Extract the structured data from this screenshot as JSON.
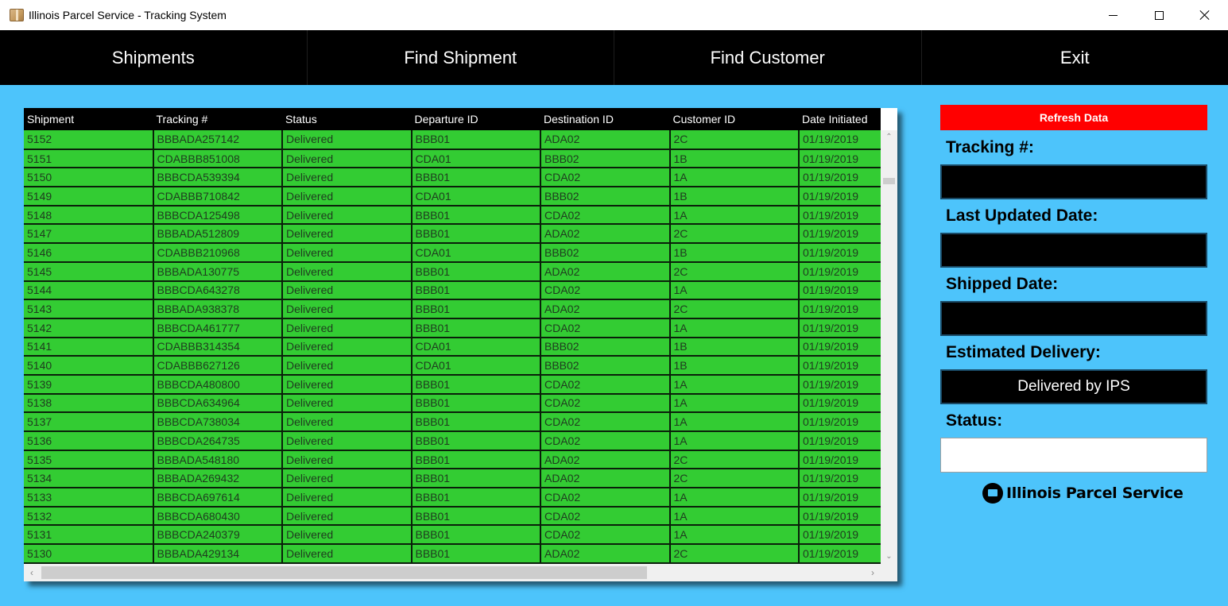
{
  "window": {
    "title": "Illinois Parcel Service - Tracking System",
    "icon": "package-box-icon"
  },
  "nav": {
    "items": [
      "Shipments",
      "Find Shipment",
      "Find Customer",
      "Exit"
    ]
  },
  "grid": {
    "columns": [
      "Shipment",
      "Tracking #",
      "Status",
      "Departure ID",
      "Destination ID",
      "Customer ID",
      "Date Initiated"
    ],
    "rows": [
      [
        "5152",
        "BBBADA257142",
        "Delivered",
        "BBB01",
        "ADA02",
        "2C",
        "01/19/2019"
      ],
      [
        "5151",
        "CDABBB851008",
        "Delivered",
        "CDA01",
        "BBB02",
        "1B",
        "01/19/2019"
      ],
      [
        "5150",
        "BBBCDA539394",
        "Delivered",
        "BBB01",
        "CDA02",
        "1A",
        "01/19/2019"
      ],
      [
        "5149",
        "CDABBB710842",
        "Delivered",
        "CDA01",
        "BBB02",
        "1B",
        "01/19/2019"
      ],
      [
        "5148",
        "BBBCDA125498",
        "Delivered",
        "BBB01",
        "CDA02",
        "1A",
        "01/19/2019"
      ],
      [
        "5147",
        "BBBADA512809",
        "Delivered",
        "BBB01",
        "ADA02",
        "2C",
        "01/19/2019"
      ],
      [
        "5146",
        "CDABBB210968",
        "Delivered",
        "CDA01",
        "BBB02",
        "1B",
        "01/19/2019"
      ],
      [
        "5145",
        "BBBADA130775",
        "Delivered",
        "BBB01",
        "ADA02",
        "2C",
        "01/19/2019"
      ],
      [
        "5144",
        "BBBCDA643278",
        "Delivered",
        "BBB01",
        "CDA02",
        "1A",
        "01/19/2019"
      ],
      [
        "5143",
        "BBBADA938378",
        "Delivered",
        "BBB01",
        "ADA02",
        "2C",
        "01/19/2019"
      ],
      [
        "5142",
        "BBBCDA461777",
        "Delivered",
        "BBB01",
        "CDA02",
        "1A",
        "01/19/2019"
      ],
      [
        "5141",
        "CDABBB314354",
        "Delivered",
        "CDA01",
        "BBB02",
        "1B",
        "01/19/2019"
      ],
      [
        "5140",
        "CDABBB627126",
        "Delivered",
        "CDA01",
        "BBB02",
        "1B",
        "01/19/2019"
      ],
      [
        "5139",
        "BBBCDA480800",
        "Delivered",
        "BBB01",
        "CDA02",
        "1A",
        "01/19/2019"
      ],
      [
        "5138",
        "BBBCDA634964",
        "Delivered",
        "BBB01",
        "CDA02",
        "1A",
        "01/19/2019"
      ],
      [
        "5137",
        "BBBCDA738034",
        "Delivered",
        "BBB01",
        "CDA02",
        "1A",
        "01/19/2019"
      ],
      [
        "5136",
        "BBBCDA264735",
        "Delivered",
        "BBB01",
        "CDA02",
        "1A",
        "01/19/2019"
      ],
      [
        "5135",
        "BBBADA548180",
        "Delivered",
        "BBB01",
        "ADA02",
        "2C",
        "01/19/2019"
      ],
      [
        "5134",
        "BBBADA269432",
        "Delivered",
        "BBB01",
        "ADA02",
        "2C",
        "01/19/2019"
      ],
      [
        "5133",
        "BBBCDA697614",
        "Delivered",
        "BBB01",
        "CDA02",
        "1A",
        "01/19/2019"
      ],
      [
        "5132",
        "BBBCDA680430",
        "Delivered",
        "BBB01",
        "CDA02",
        "1A",
        "01/19/2019"
      ],
      [
        "5131",
        "BBBCDA240379",
        "Delivered",
        "BBB01",
        "CDA02",
        "1A",
        "01/19/2019"
      ],
      [
        "5130",
        "BBBADA429134",
        "Delivered",
        "BBB01",
        "ADA02",
        "2C",
        "01/19/2019"
      ]
    ]
  },
  "panel": {
    "refresh_label": "Refresh Data",
    "tracking_label": "Tracking #:",
    "tracking_value": "",
    "last_updated_label": "Last Updated Date:",
    "last_updated_value": "",
    "shipped_label": "Shipped Date:",
    "shipped_value": "",
    "estimated_label": "Estimated Delivery:",
    "estimated_value": "Delivered by IPS",
    "status_label": "Status:",
    "status_value": ""
  },
  "logo": {
    "text": "Illinois Parcel Service",
    "icon": "truck-logo-icon"
  },
  "colors": {
    "background": "#4dc4fb",
    "nav_bg": "#000000",
    "row_bg": "#33cc33",
    "refresh_bg": "#ff0000"
  }
}
